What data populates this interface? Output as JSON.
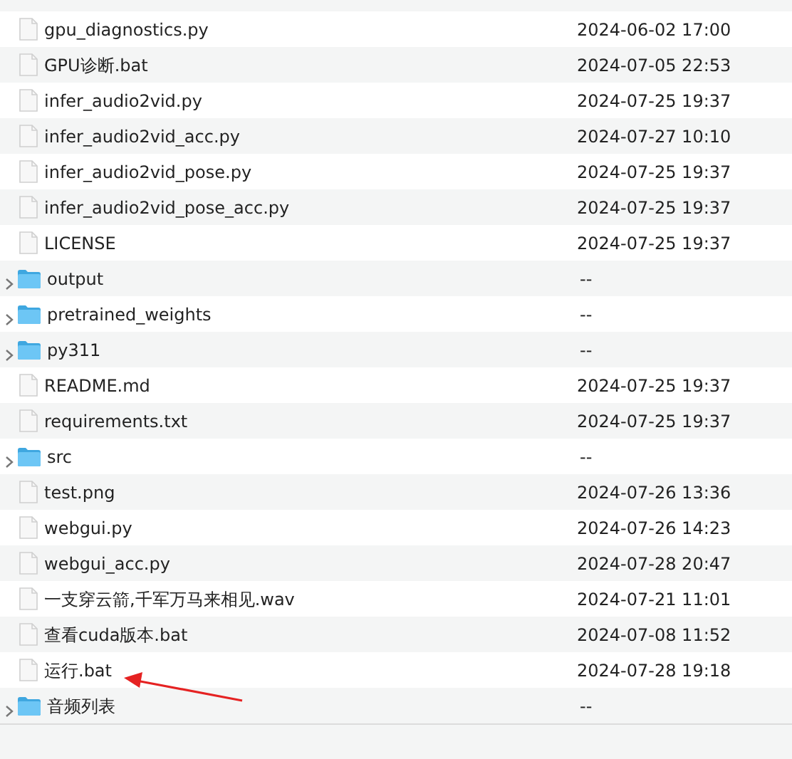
{
  "files": [
    {
      "kind": "file",
      "name": "gpu_diagnostics.py",
      "modified": "2024-06-02 17:00"
    },
    {
      "kind": "file",
      "name": "GPU诊断.bat",
      "modified": "2024-07-05 22:53"
    },
    {
      "kind": "file",
      "name": "infer_audio2vid.py",
      "modified": "2024-07-25 19:37"
    },
    {
      "kind": "file",
      "name": "infer_audio2vid_acc.py",
      "modified": "2024-07-27 10:10"
    },
    {
      "kind": "file",
      "name": "infer_audio2vid_pose.py",
      "modified": "2024-07-25 19:37"
    },
    {
      "kind": "file",
      "name": "infer_audio2vid_pose_acc.py",
      "modified": "2024-07-25 19:37"
    },
    {
      "kind": "file",
      "name": "LICENSE",
      "modified": "2024-07-25 19:37"
    },
    {
      "kind": "folder",
      "name": "output",
      "modified": "--",
      "expanded": false
    },
    {
      "kind": "folder",
      "name": "pretrained_weights",
      "modified": "--",
      "expanded": false
    },
    {
      "kind": "folder",
      "name": "py311",
      "modified": "--",
      "expanded": false
    },
    {
      "kind": "file",
      "name": "README.md",
      "modified": "2024-07-25 19:37"
    },
    {
      "kind": "file",
      "name": "requirements.txt",
      "modified": "2024-07-25 19:37"
    },
    {
      "kind": "folder",
      "name": "src",
      "modified": "--",
      "expanded": false
    },
    {
      "kind": "file",
      "name": "test.png",
      "modified": "2024-07-26 13:36"
    },
    {
      "kind": "file",
      "name": "webgui.py",
      "modified": "2024-07-26 14:23"
    },
    {
      "kind": "file",
      "name": "webgui_acc.py",
      "modified": "2024-07-28 20:47"
    },
    {
      "kind": "file",
      "name": "一支穿云箭,千军万马来相见.wav",
      "modified": "2024-07-21 11:01"
    },
    {
      "kind": "file",
      "name": "查看cuda版本.bat",
      "modified": "2024-07-08 11:52"
    },
    {
      "kind": "file",
      "name": "运行.bat",
      "modified": "2024-07-28 19:18"
    },
    {
      "kind": "folder",
      "name": "音频列表",
      "modified": "--",
      "expanded": false
    }
  ]
}
